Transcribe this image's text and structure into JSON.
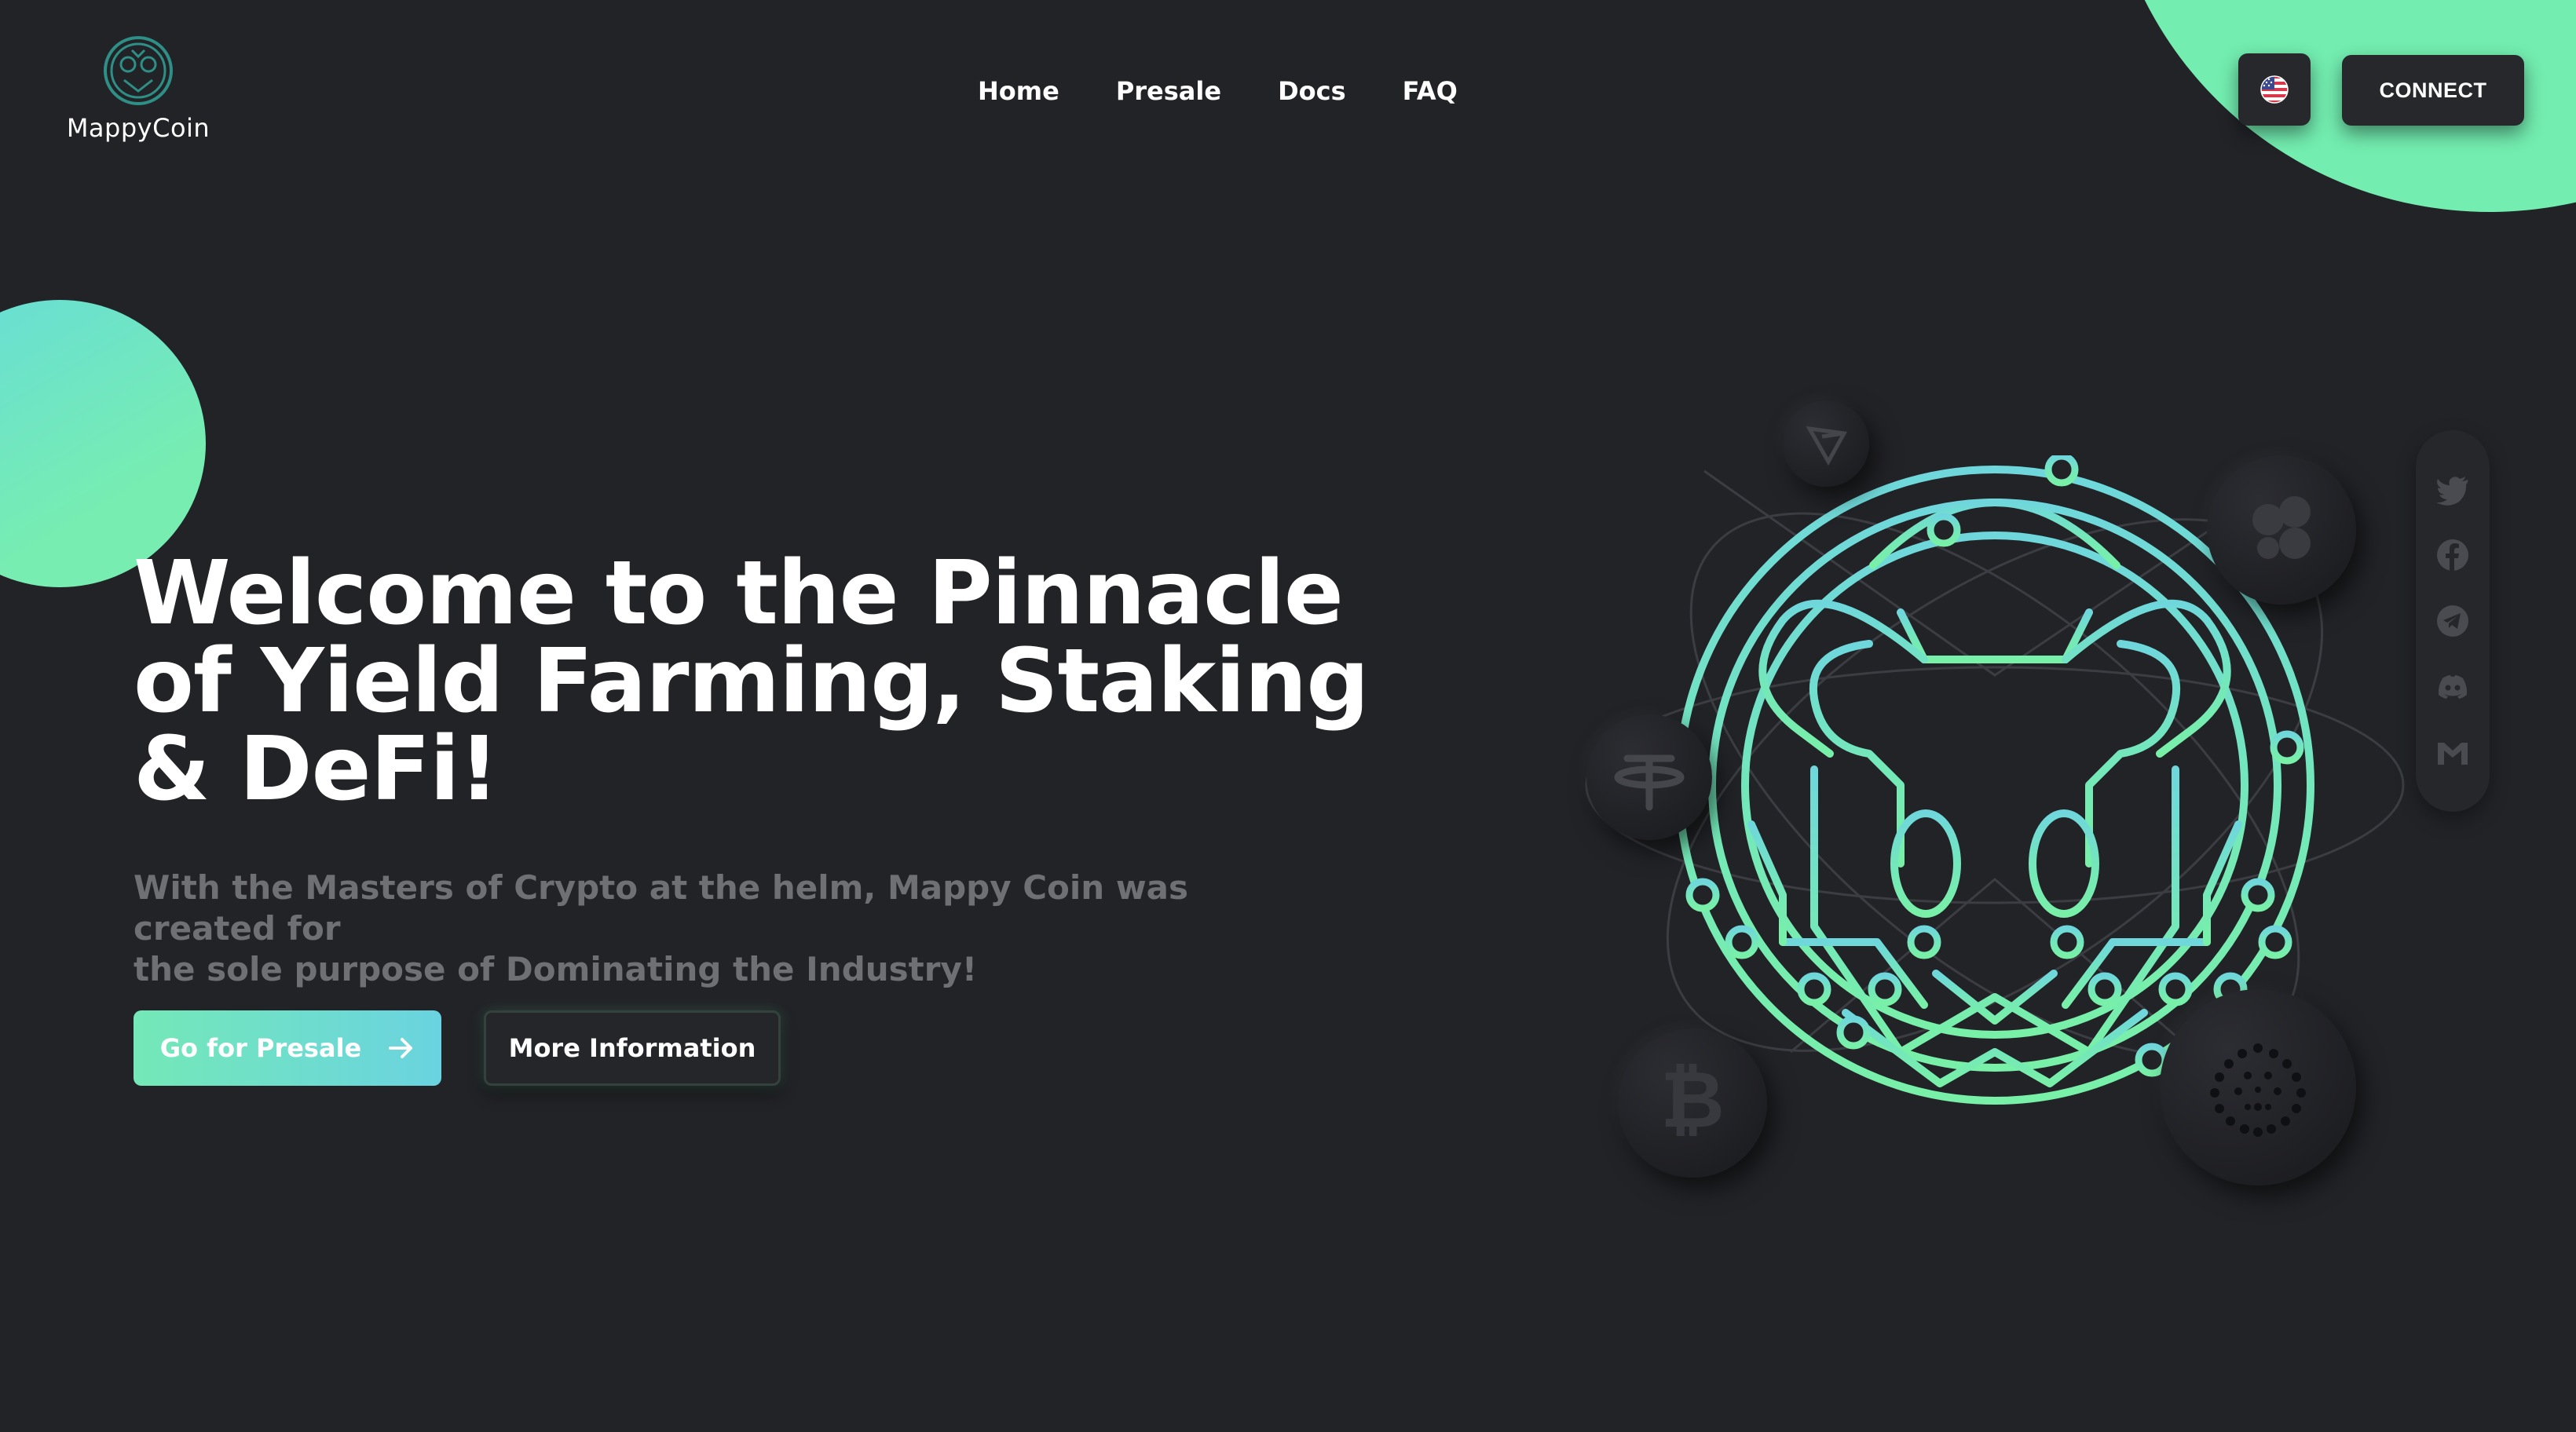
{
  "brand": {
    "name": "MappyCoin",
    "logo_icon": "mappy-logo-icon"
  },
  "nav": {
    "items": [
      {
        "label": "Home"
      },
      {
        "label": "Presale"
      },
      {
        "label": "Docs"
      },
      {
        "label": "FAQ"
      }
    ]
  },
  "header": {
    "language_icon": "us-flag-icon",
    "connect_label": "CONNECT"
  },
  "hero": {
    "title_line1": "Welcome to the Pinnacle",
    "title_line2": "of Yield Farming, Staking",
    "title_line3": "& DeFi!",
    "subtitle_line1": "With the Masters of Crypto at the helm, Mappy Coin was created for",
    "subtitle_line2": "the sole purpose of Dominating the Industry!",
    "primary_button": "Go for Presale",
    "primary_button_icon": "arrow-right-icon",
    "secondary_button": "More Information"
  },
  "illustration": {
    "coins": [
      "tron-coin-icon",
      "xrp-coin-icon",
      "tether-coin-icon",
      "bitcoin-coin-icon",
      "iota-coin-icon"
    ],
    "emblem": "mappy-circuit-emblem"
  },
  "social": [
    "twitter-icon",
    "facebook-icon",
    "telegram-icon",
    "discord-icon",
    "gmail-icon"
  ],
  "colors": {
    "background": "#222327",
    "accent": "#73edb0",
    "accent_cyan": "#6ad3e0",
    "muted_text": "#6f7074",
    "icon_gray": "#4a4b50"
  }
}
